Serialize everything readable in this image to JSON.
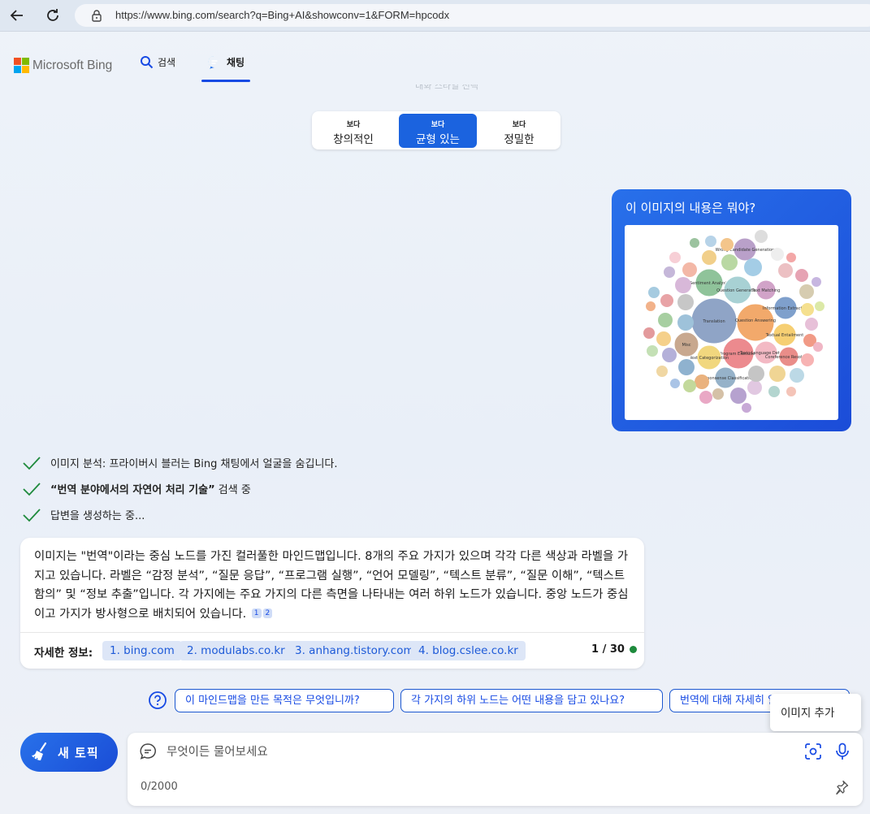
{
  "browser": {
    "url": "https://www.bing.com/search?q=Bing+AI&showconv=1&FORM=hpcodx"
  },
  "header": {
    "logo_text": "Microsoft Bing",
    "tab_search": "검색",
    "tab_chat": "채팅"
  },
  "faded_text": "대화 스타일 선택",
  "style_selector": {
    "options": [
      {
        "small": "보다",
        "big": "창의적인"
      },
      {
        "small": "보다",
        "big": "균형 있는"
      },
      {
        "small": "보다",
        "big": "정밀한"
      }
    ],
    "selected": 1
  },
  "user_message": {
    "text": "이 이미지의 내용은 뭐야?",
    "image_topics": [
      "Translation",
      "Question Answering",
      "Sentiment Analysis",
      "Question Generation",
      "Program Execution",
      "Text Categorization",
      "Misc",
      "Text Matching",
      "Information Extraction",
      "Textual Entailment",
      "Toxic Language Detection",
      "Wrong Candidate Generation",
      "Coreference Resolution",
      "Commonsense Classification"
    ]
  },
  "progress_steps": [
    {
      "text": "이미지 분석: 프라이버시 블러는 Bing 채팅에서 얼굴을 숨깁니다."
    },
    {
      "bold": "“번역 분야에서의 자연어 처리 기술”",
      "text": " 검색 중"
    },
    {
      "text": "답변을 생성하는 중..."
    }
  ],
  "answer": {
    "text": "이미지는 \"번역\"이라는 중심 노드를 가진 컬러풀한 마인드맵입니다. 8개의 주요 가지가 있으며 각각 다른 색상과 라벨을 가지고 있습니다. 라벨은 “감정 분석”, “질문 응답”, “프로그램 실행”, “언어 모델링”, “텍스트 분류”, “질문 이해”, “텍스트 함의” 및 “정보 추출”입니다. 각 가지에는 주요 가지의 다른 측면을 나타내는 여러 하위 노드가 있습니다. 중앙 노드가 중심이고 가지가 방사형으로 배치되어 있습니다.",
    "citations": [
      "1",
      "2"
    ],
    "more_label": "자세한 정보:",
    "sources": [
      "1. bing.com",
      "2. modulabs.co.kr",
      "3. anhang.tistory.com",
      "4. blog.cslee.co.kr"
    ],
    "page_count": "1 / 30",
    "status_color": "#1e8a3c"
  },
  "suggestions": [
    "이 마인드맵을 만든 목적은 무엇입니까?",
    "각 가지의 하위 노드는 어떤 내용을 담고 있나요?",
    "번역에 대해 자세히 알려주세요"
  ],
  "tooltip": "이미지 추가",
  "new_topic_label": "새 토픽",
  "input": {
    "placeholder": "무엇이든 물어보세요",
    "char_count": "0/2000"
  },
  "colors": {
    "accent": "#174ae4",
    "check_green": "#1e8a3c"
  }
}
